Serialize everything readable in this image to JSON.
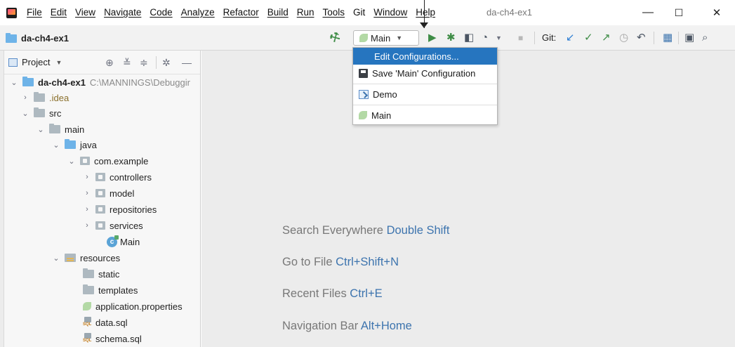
{
  "menu": {
    "items": [
      "File",
      "Edit",
      "View",
      "Navigate",
      "Code",
      "Analyze",
      "Refactor",
      "Build",
      "Run",
      "Tools",
      "Git",
      "Window",
      "Help"
    ],
    "window_title": "da-ch4-ex1"
  },
  "window_controls": {
    "minimize": "—",
    "maximize": "☐",
    "close": "✕"
  },
  "navbar": {
    "project_name": "da-ch4-ex1",
    "run_config": "Main",
    "git_label": "Git:"
  },
  "project_panel": {
    "selector_label": "Project",
    "tree": {
      "root": {
        "name": "da-ch4-ex1",
        "path": "C:\\MANNINGS\\Debuggir"
      },
      "idea": ".idea",
      "src": "src",
      "main": "main",
      "java": "java",
      "package": "com.example",
      "controllers": "controllers",
      "model": "model",
      "repositories": "repositories",
      "services": "services",
      "main_class": "Main",
      "resources": "resources",
      "static": "static",
      "templates": "templates",
      "app_props": "application.properties",
      "data_sql": "data.sql",
      "schema_sql": "schema.sql"
    }
  },
  "editor_hints": [
    {
      "text": "Search Everywhere",
      "key": "Double Shift"
    },
    {
      "text": "Go to File",
      "key": "Ctrl+Shift+N"
    },
    {
      "text": "Recent Files",
      "key": "Ctrl+E"
    },
    {
      "text": "Navigation Bar",
      "key": "Alt+Home"
    }
  ],
  "popup": {
    "edit_configs": "Edit Configurations...",
    "save_config": "Save 'Main' Configuration",
    "demo": "Demo",
    "main": "Main"
  },
  "colors": {
    "selection": "#2675bf",
    "run_green": "#3e8c46",
    "key_blue": "#3d74ae"
  }
}
